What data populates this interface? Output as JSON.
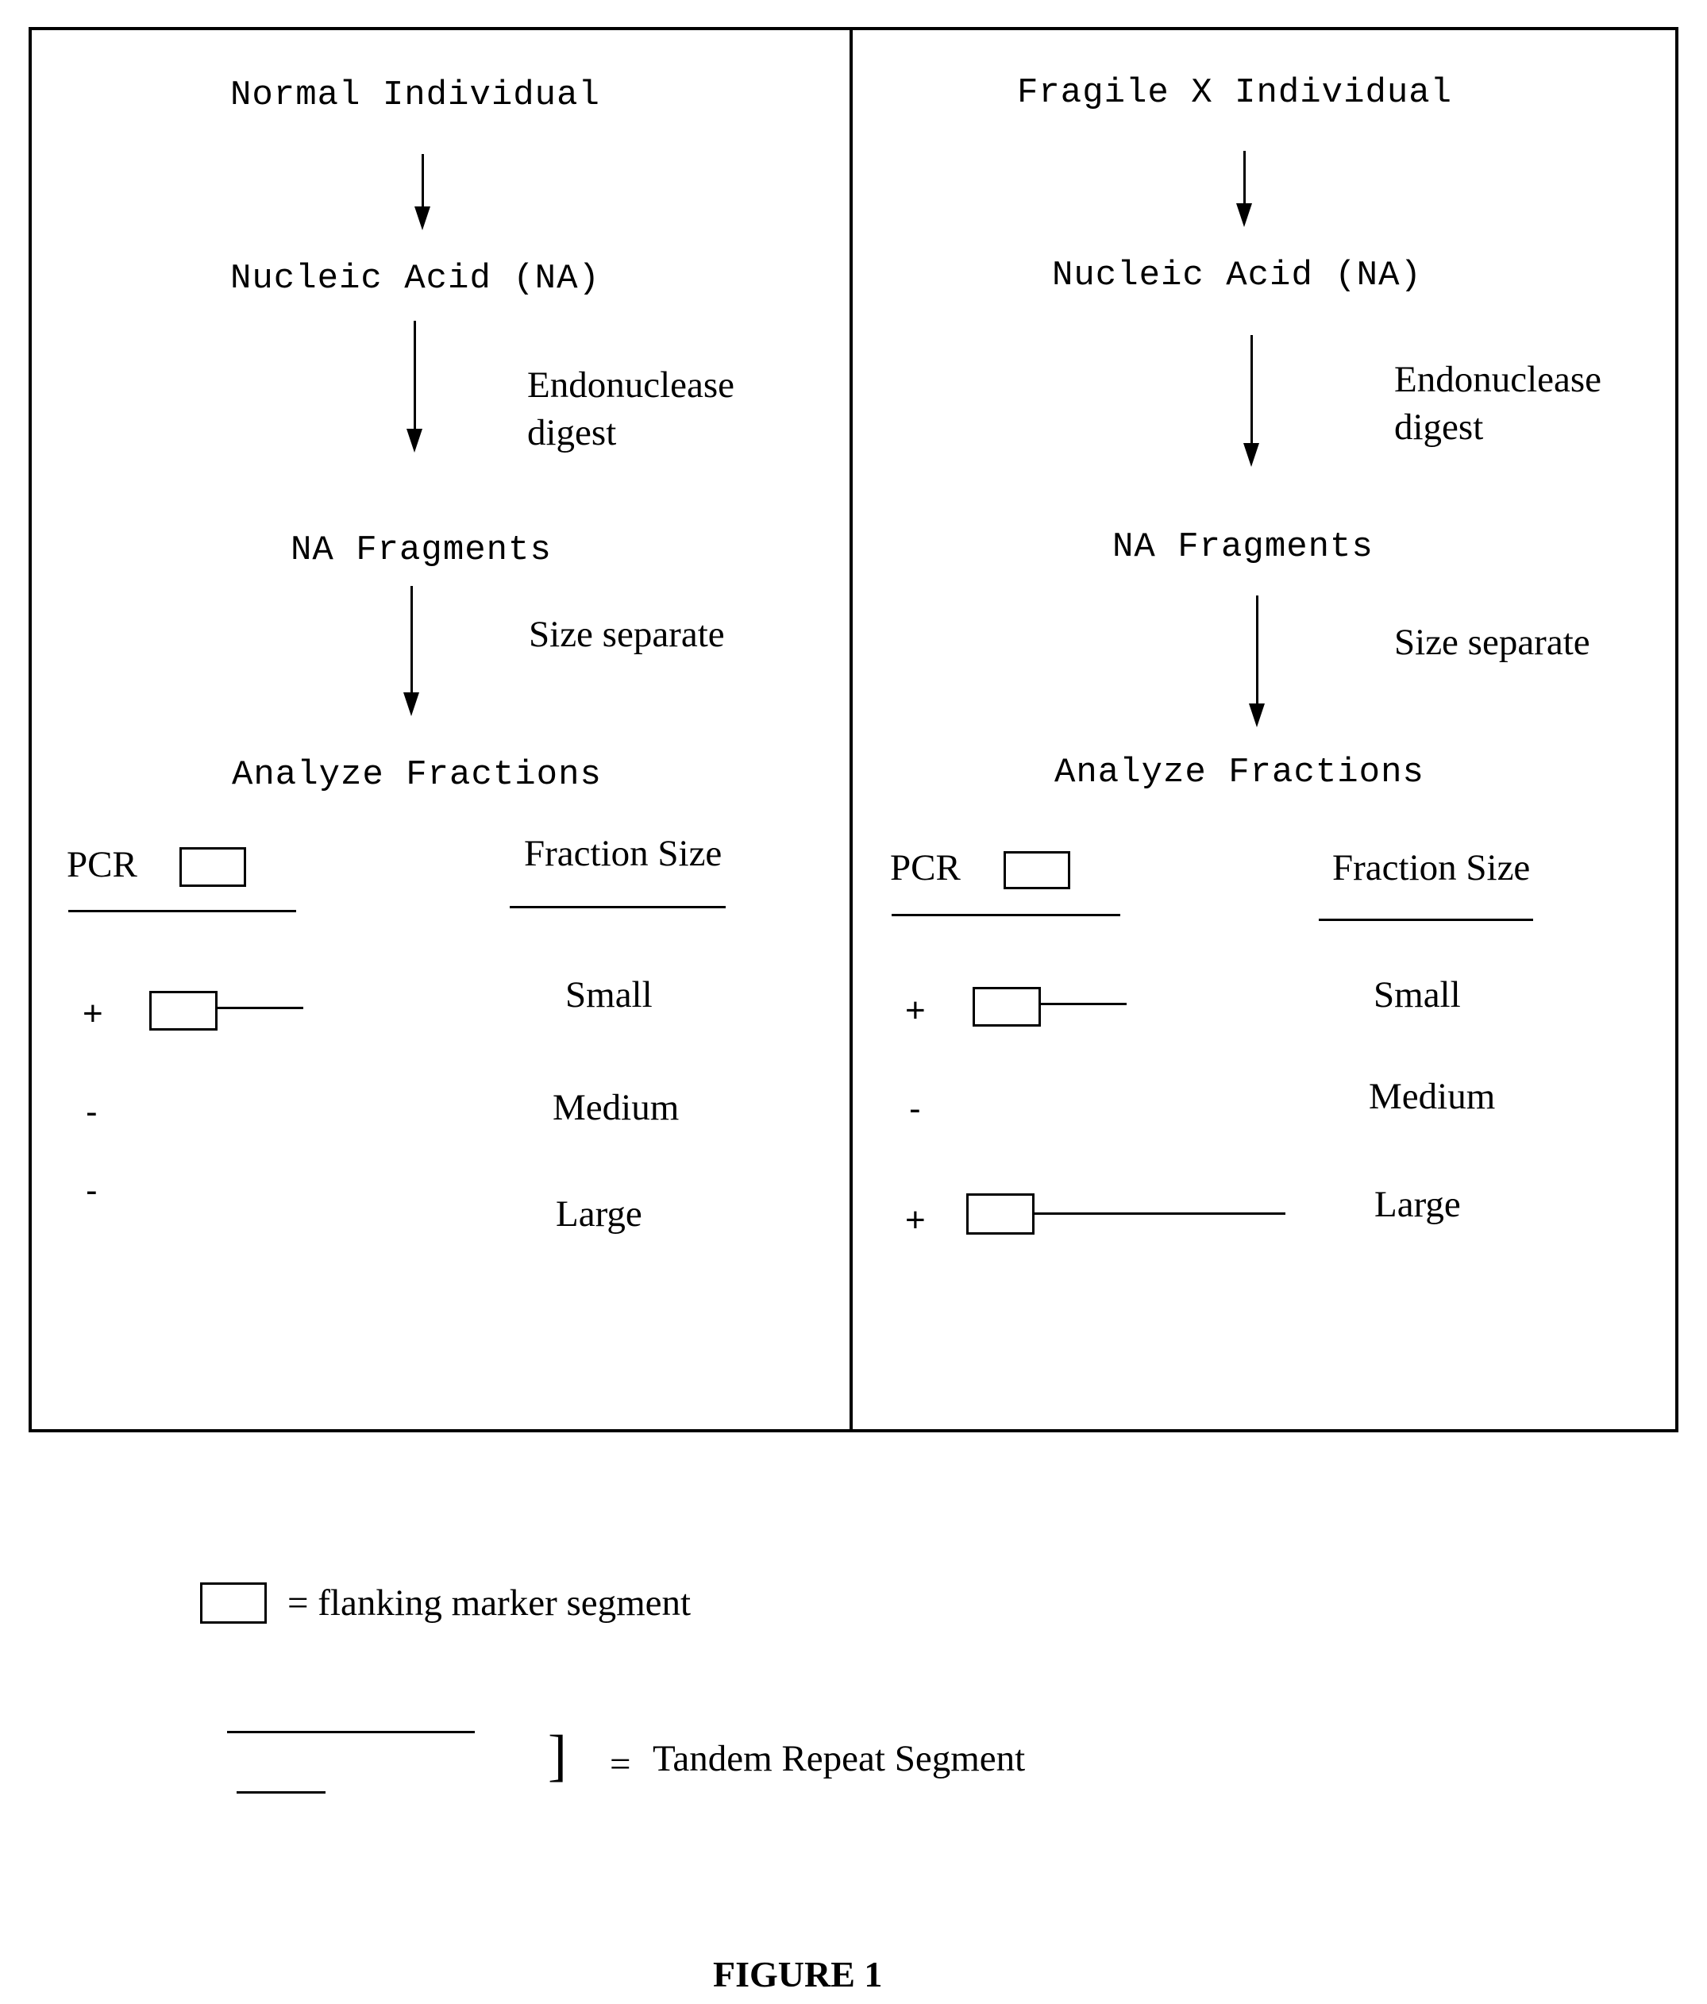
{
  "figure": {
    "caption": "FIGURE 1",
    "panels": [
      {
        "id": "normal",
        "title": "Normal Individual",
        "steps": [
          {
            "label": "Nucleic Acid (NA)"
          },
          {
            "label": "NA Fragments"
          },
          {
            "label": "Analyze Fractions"
          }
        ],
        "arrow_labels": {
          "digest_line1": "Endonuclease",
          "digest_line2": "digest",
          "separate": "Size separate"
        },
        "table": {
          "pcr_header": "PCR",
          "size_header": "Fraction Size",
          "rows": [
            {
              "result": "+",
              "product": "short",
              "size": "Small"
            },
            {
              "result": "-",
              "product": "none",
              "size": "Medium"
            },
            {
              "result": "-",
              "product": "none",
              "size": "Large"
            }
          ]
        }
      },
      {
        "id": "fragile-x",
        "title": "Fragile X Individual",
        "steps": [
          {
            "label": "Nucleic Acid (NA)"
          },
          {
            "label": "NA Fragments"
          },
          {
            "label": "Analyze Fractions"
          }
        ],
        "arrow_labels": {
          "digest_line1": "Endonuclease",
          "digest_line2": "digest",
          "separate": "Size separate"
        },
        "table": {
          "pcr_header": "PCR",
          "size_header": "Fraction Size",
          "rows": [
            {
              "result": "+",
              "product": "short",
              "size": "Small"
            },
            {
              "result": "-",
              "product": "none",
              "size": "Medium"
            },
            {
              "result": "+",
              "product": "long",
              "size": "Large"
            }
          ]
        }
      }
    ],
    "legend": {
      "marker_label": "= flanking marker segment",
      "repeat_eq": "=",
      "repeat_label": "Tandem Repeat Segment",
      "bracket": "]"
    }
  }
}
